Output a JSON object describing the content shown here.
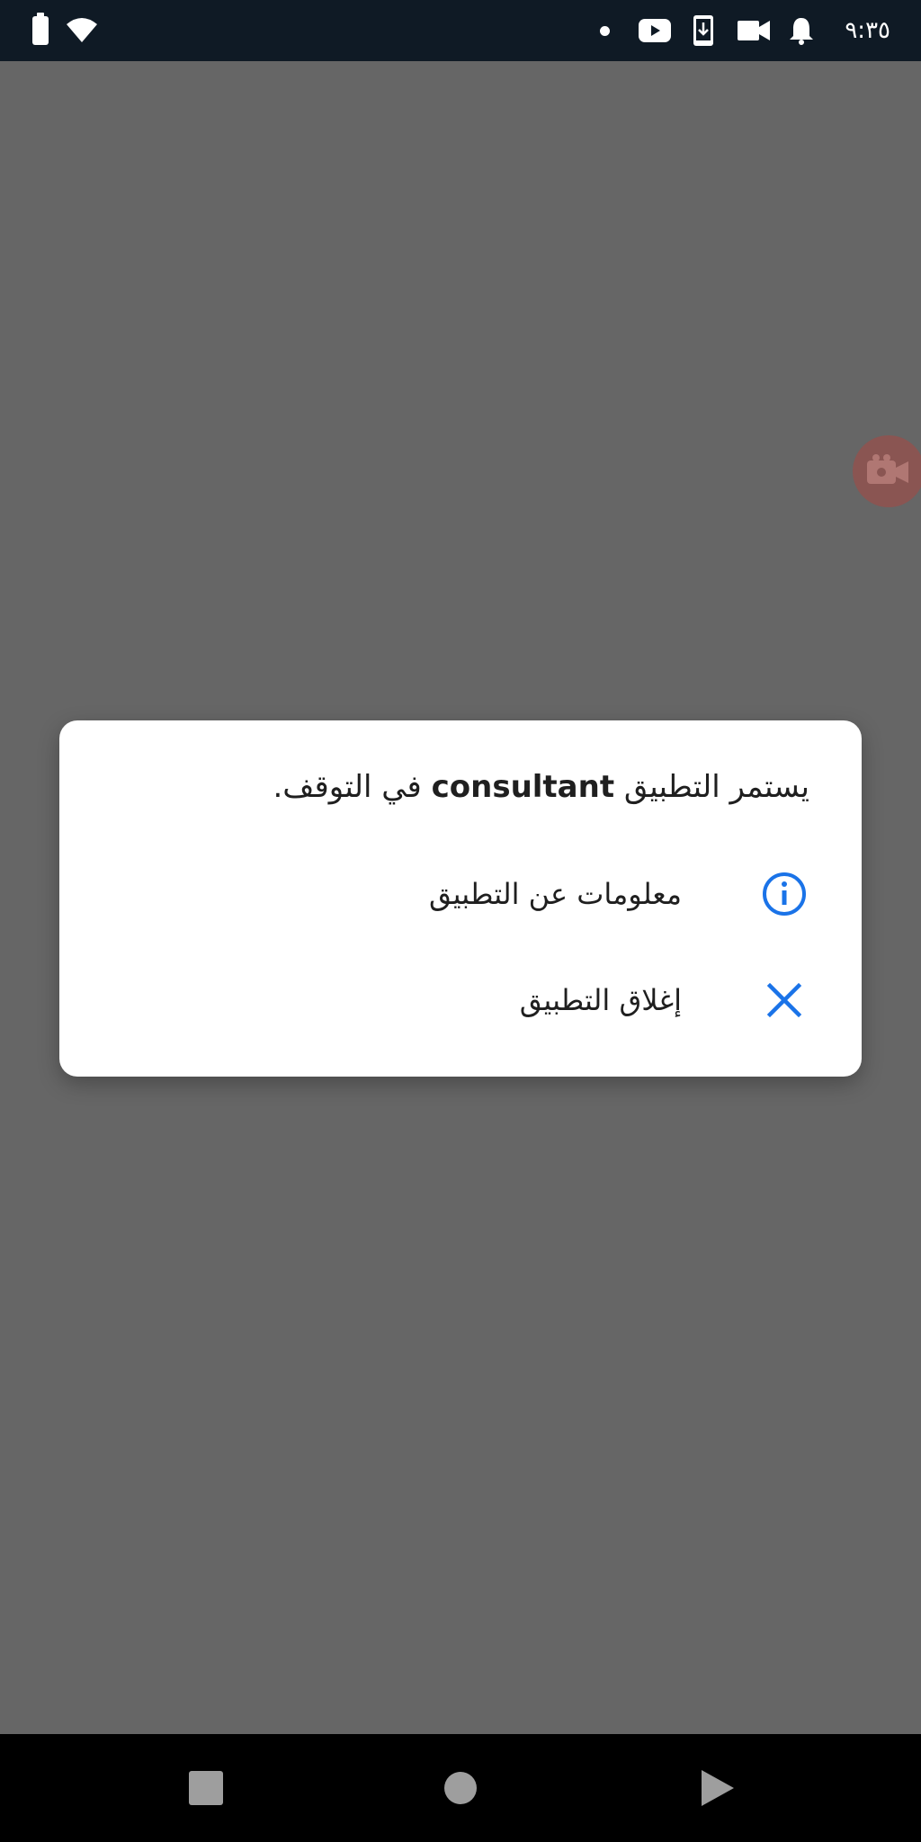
{
  "status_bar": {
    "time": "٩:٣٥",
    "icons": [
      "battery-icon",
      "wifi-icon",
      "dot-icon",
      "youtube-icon",
      "download-icon",
      "video-camera-icon",
      "bell-icon"
    ]
  },
  "dialog": {
    "title_prefix": "يستمر التطبيق",
    "app_name": "consultant",
    "title_suffix": "في التوقف.",
    "items": [
      {
        "label": "معلومات عن التطبيق",
        "icon": "info-icon"
      },
      {
        "label": "إغلاق التطبيق",
        "icon": "close-icon"
      }
    ]
  },
  "nav_bar": {
    "buttons": [
      "recents-button",
      "home-button",
      "back-button"
    ]
  },
  "colors": {
    "scrim": "#666666",
    "status_bar": "#0f1a25",
    "accent": "#1a73e8",
    "nav_bar": "#000000"
  }
}
